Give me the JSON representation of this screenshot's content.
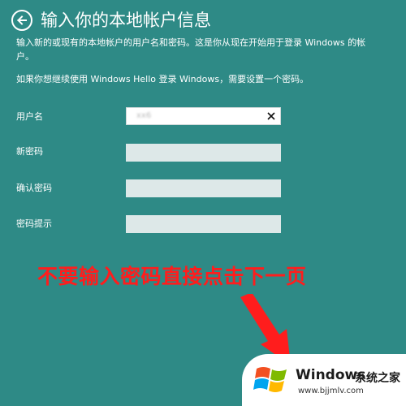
{
  "header": {
    "title": "输入你的本地帐户信息"
  },
  "description": {
    "line1": "输入新的或现有的本地帐户的用户名和密码。这是你从现在开始用于登录 Windows 的帐户。",
    "line2": "如果你想继续使用 Windows Hello 登录 Windows，需要设置一个密码。"
  },
  "form": {
    "username_label": "用户名",
    "username_value": "xx6",
    "new_password_label": "新密码",
    "confirm_password_label": "确认密码",
    "password_hint_label": "密码提示"
  },
  "annotation": {
    "text": "不要输入密码直接点击下一页",
    "color": "#ff1d1d"
  },
  "watermark": {
    "brand": "Windows",
    "site_name": "系统之家",
    "url": "www.bjjmlv.com"
  },
  "colors": {
    "background": "#2e8a86",
    "input_fill": "#dde8e8"
  }
}
